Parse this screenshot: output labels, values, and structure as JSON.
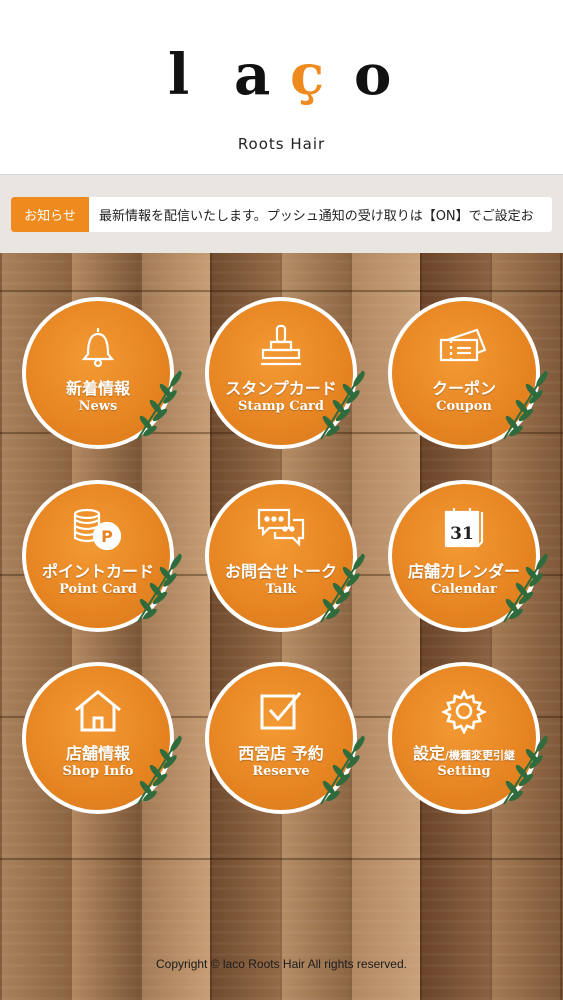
{
  "header": {
    "logo_letters": [
      "l",
      "a",
      "ç",
      "o"
    ],
    "logo_sub": "Roots Hair"
  },
  "notice": {
    "tag": "お知らせ",
    "text": "最新情報を配信いたします。プッシュ通知の受け取りは【ON】でご設定お"
  },
  "menu": [
    {
      "jp": "新着情報",
      "en": "News",
      "icon": "bell-icon"
    },
    {
      "jp": "スタンプカード",
      "en": "Stamp Card",
      "icon": "stamp-icon"
    },
    {
      "jp": "クーポン",
      "en": "Coupon",
      "icon": "ticket-icon"
    },
    {
      "jp": "ポイントカード",
      "en": "Point Card",
      "icon": "coins-icon"
    },
    {
      "jp": "お問合せトーク",
      "en": "Talk",
      "icon": "chat-icon"
    },
    {
      "jp": "店舗カレンダー",
      "en": "Calendar",
      "icon": "calendar-icon",
      "calendar_day": "31"
    },
    {
      "jp": "店舗情報",
      "en": "Shop Info",
      "icon": "house-icon"
    },
    {
      "jp": "西宮店 予約",
      "en": "Reserve",
      "icon": "checkbox-icon"
    },
    {
      "jp": "設定",
      "jp_small": "/機種変更引継",
      "en": "Setting",
      "icon": "gear-icon"
    }
  ],
  "footer": {
    "copyright": "Copyright © laco Roots Hair All rights reserved."
  },
  "colors": {
    "accent": "#ef8a1f",
    "button_fill": "#eb8a26",
    "leaf": "#2f6b3c"
  }
}
